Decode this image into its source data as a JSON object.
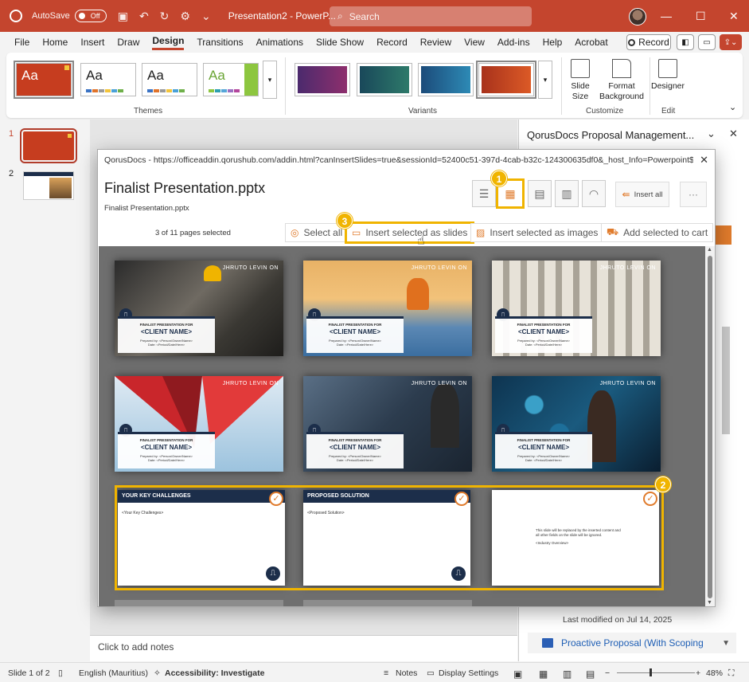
{
  "window": {
    "autosave_label": "AutoSave",
    "autosave_state": "Off",
    "doc_title": "Presentation2 - PowerP...",
    "search_placeholder": "Search"
  },
  "menu": {
    "items": [
      "File",
      "Home",
      "Insert",
      "Draw",
      "Design",
      "Transitions",
      "Animations",
      "Slide Show",
      "Record",
      "Review",
      "View",
      "Add-ins",
      "Help",
      "Acrobat"
    ],
    "active": "Design",
    "record_label": "Record"
  },
  "ribbon": {
    "theme_label": "Aa",
    "themes_group": "Themes",
    "variants_group": "Variants",
    "customize_group": "Customize",
    "edit_group": "Edit",
    "slide_size": "Slide Size",
    "format_background": "Format Background",
    "designer": "Designer"
  },
  "slides_pane": {
    "numbers": [
      "1",
      "2"
    ]
  },
  "notes": {
    "placeholder": "Click to add notes"
  },
  "taskpane": {
    "title": "QorusDocs Proposal Management...",
    "last_modified": "Last modified on  Jul 14, 2025",
    "item_label": "Proactive Proposal (With Scoping"
  },
  "dialog": {
    "url": "QorusDocs - https://officeaddin.qorushub.com/addin.html?canInsertSlides=true&sessionId=52400c51-397d-4cab-b32c-124300635df0&_host_Info=Powerpoint$Win32...",
    "title": "Finalist Presentation.pptx",
    "subtitle": "Finalist Presentation.pptx",
    "insert_all": "Insert all",
    "pages_selected": "3 of 11 pages selected",
    "select_all": "Select all",
    "insert_as_slides": "Insert selected as slides",
    "insert_as_images": "Insert selected as images",
    "add_to_cart": "Add selected to cart",
    "badges": [
      "1",
      "2",
      "3"
    ]
  },
  "slides": {
    "logo_text": "JHRUTO LEVIN ON",
    "finalist_line": "FINALIST PRESENTATION FOR",
    "client_name": "<CLIENT NAME>",
    "prepared_by": "Prepared by: <Person/Owner/Name>",
    "date_line": "Date: <Period/Date/Here>",
    "challenges_title": "YOUR KEY CHALLENGES",
    "challenges_placeholder": "<Your Key Challenges>",
    "solution_title": "PROPOSED SOLUTION",
    "solution_placeholder": "<Proposed Solution>",
    "slide9_text": "This slide will be replaced by the inserted content and all other fields on the slide will be ignored.",
    "slide9_placeholder": "<Industry Overview>"
  },
  "statusbar": {
    "slide_count": "Slide 1 of 2",
    "language": "English (Mauritius)",
    "accessibility": "Accessibility: Investigate",
    "notes": "Notes",
    "display_settings": "Display Settings",
    "zoom": "48%"
  },
  "colors": {
    "accent": "#c4452e",
    "highlight": "#f0b400",
    "qorus_orange": "#e07b2c",
    "navy": "#1c2e4a"
  }
}
